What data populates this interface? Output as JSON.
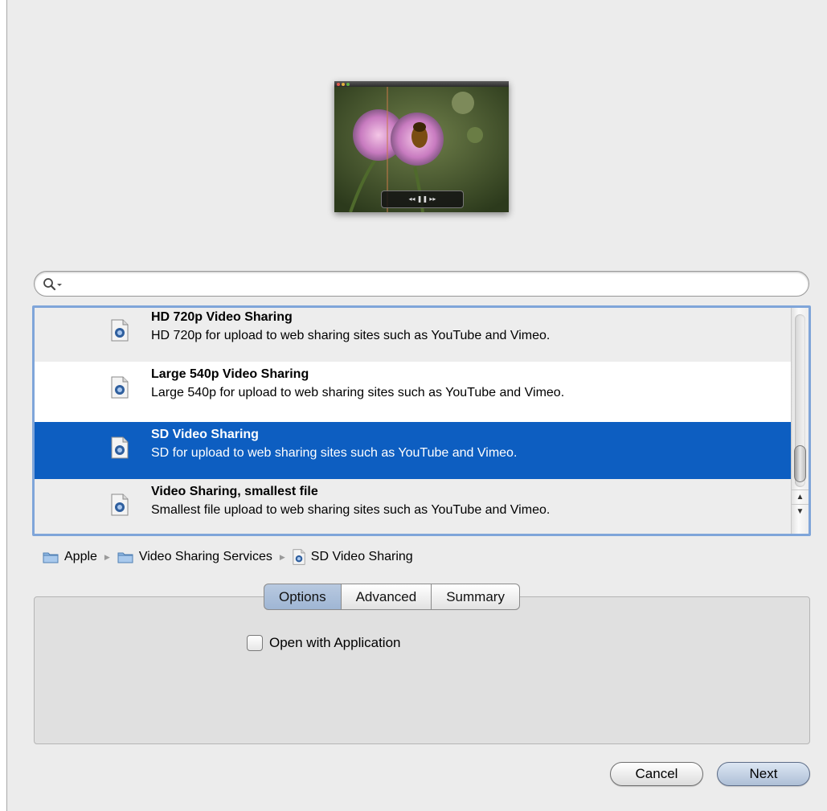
{
  "search": {
    "value": "",
    "placeholder": ""
  },
  "list": {
    "items": [
      {
        "title": "HD 720p Video Sharing",
        "description": "HD 720p for upload to web sharing sites such as YouTube and Vimeo.",
        "selected": false
      },
      {
        "title": "Large 540p Video Sharing",
        "description": "Large 540p for upload to web sharing sites such as YouTube and Vimeo.",
        "selected": false
      },
      {
        "title": "SD Video Sharing",
        "description": "SD for upload to web sharing sites such as YouTube and Vimeo.",
        "selected": true
      },
      {
        "title": "Video Sharing, smallest file",
        "description": "Smallest file upload to web sharing sites such as YouTube and Vimeo.",
        "selected": false
      }
    ]
  },
  "path": {
    "items": [
      "Apple",
      "Video Sharing Services",
      "SD Video Sharing"
    ]
  },
  "tabs": {
    "items": [
      "Options",
      "Advanced",
      "Summary"
    ],
    "active": "Options"
  },
  "options": {
    "open_with_application": {
      "label": "Open with Application",
      "checked": false
    }
  },
  "buttons": {
    "cancel": "Cancel",
    "next": "Next"
  },
  "colors": {
    "selection": "#0d5ec1",
    "focus_ring": "#7fa5d9",
    "window": "#ececec",
    "tab_active": "#a9bdd8"
  },
  "icons": {
    "search": "magnifier-with-dropdown-icon",
    "preset": "quicktime-document-icon",
    "folder": "blue-folder-icon",
    "path_separator": "triangle-right-icon"
  }
}
